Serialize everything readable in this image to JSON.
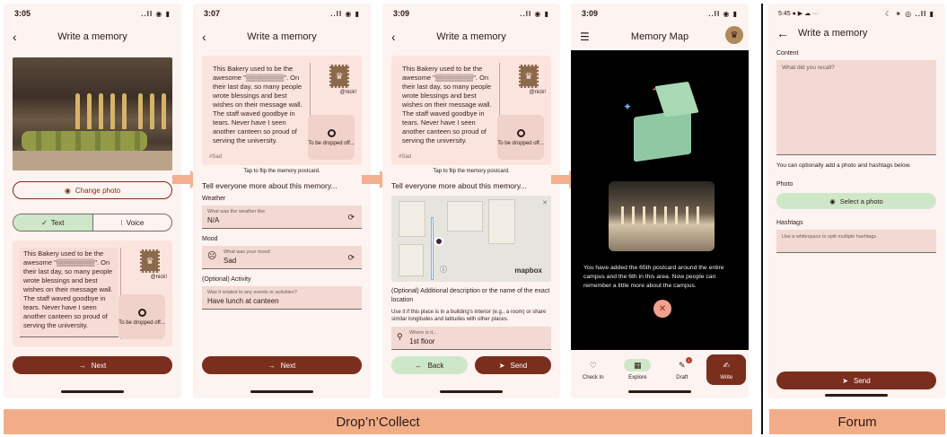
{
  "common": {
    "write_title": "Write a memory",
    "memory_text": "This Bakery used to be the awesome \"▒▒▒▒▒▒▒▒\". On their last day, so many people wrote blessings and best wishes on their message wall. The staff waved goodbye in tears. Never have I seen another canteen so proud of serving the university.",
    "handle": "@nick!",
    "drop_label": "To be dropped off...",
    "mood_tag": "#Sad",
    "tap_flip": "Tap to flip the memory postcard.",
    "tell_more": "Tell everyone more about this memory..."
  },
  "screen1": {
    "time": "3:05",
    "status_icons": "..ll ◉ ▮",
    "change_photo": "Change photo",
    "tab_text": "Text",
    "tab_voice": "Voice",
    "next": "Next"
  },
  "screen2": {
    "time": "3:07",
    "status_icons": "..ll ◉ ▮",
    "weather_label": "Weather",
    "weather_placeholder": "What was the weather like",
    "weather_value": "N/A",
    "mood_label": "Mood",
    "mood_placeholder": "What was your mood",
    "mood_value": "Sad",
    "activity_label": "(Optional) Activity",
    "activity_placeholder": "Was it related to any events or activities?",
    "activity_value": "Have lunch at canteen",
    "next": "Next"
  },
  "screen3": {
    "time": "3:09",
    "status_icons": "..ll ◉ ▮",
    "map_logo": "mapbox",
    "location_label": "(Optional) Additional description or the name of the exact location",
    "location_desc": "Use it if this place is in a building's interior (e.g., a room) or share similar longitudes and latitudes with other places.",
    "where_placeholder": "Where is it...",
    "where_value": "1st floor",
    "back": "Back",
    "send": "Send"
  },
  "screen4": {
    "time": "3:09",
    "status_icons": "..ll ◉ ▮",
    "title": "Memory Map",
    "message": "You have added the 65th postcard around the entire campus and the 6th in this area. Now people can remember a little more about the campus.",
    "nav": [
      {
        "label": "Check In",
        "icon": "♡"
      },
      {
        "label": "Explore",
        "icon": "▦"
      },
      {
        "label": "Draft",
        "icon": "✎"
      },
      {
        "label": "Write",
        "icon": "✍"
      }
    ],
    "draft_badge": "1"
  },
  "screen5": {
    "time": "5:45",
    "status_left_icons": "● ▶ ☁ ···",
    "status_icons": "☾ ✶ ◎ ..ll ▮",
    "title": "Write a memory",
    "content_label": "Content",
    "content_placeholder": "What did you recall?",
    "optional_note": "You can optionally add a photo and hashtags below.",
    "photo_label": "Photo",
    "select_photo": "Select a photo",
    "hashtags_label": "Hashtags",
    "hashtags_placeholder": "Use a whitespace to split multiple hashtags",
    "send": "Send"
  },
  "labels": {
    "left": "Drop’n’Collect",
    "right": "Forum"
  },
  "colors": {
    "primary": "#7a2e1e",
    "surface": "#fdf3f0",
    "accent_green": "#cfe7c9",
    "arrow": "#f4b08c",
    "banner": "#f2ad88"
  }
}
